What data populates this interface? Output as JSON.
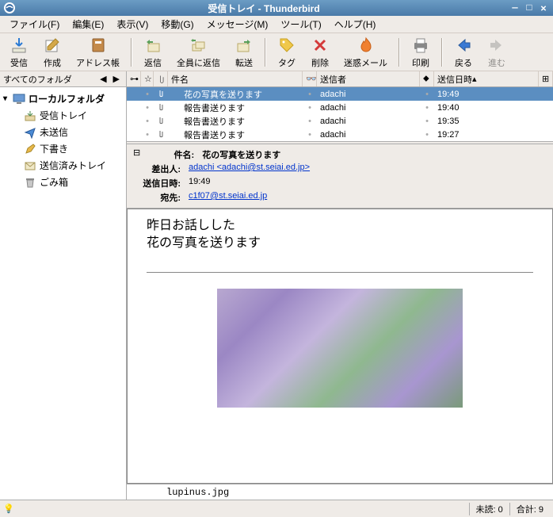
{
  "window": {
    "title": "受信トレイ  -  Thunderbird"
  },
  "menu": {
    "file": "ファイル(F)",
    "edit": "編集(E)",
    "view": "表示(V)",
    "go": "移動(G)",
    "message": "メッセージ(M)",
    "tools": "ツール(T)",
    "help": "ヘルプ(H)"
  },
  "toolbar": {
    "get": "受信",
    "write": "作成",
    "addressbook": "アドレス帳",
    "reply": "返信",
    "replyall": "全員に返信",
    "forward": "転送",
    "tag": "タグ",
    "delete": "削除",
    "junk": "迷惑メール",
    "print": "印刷",
    "back": "戻る",
    "forward_nav": "進む"
  },
  "sidebar": {
    "header": "すべてのフォルダ",
    "root": "ローカルフォルダ",
    "items": [
      {
        "label": "受信トレイ"
      },
      {
        "label": "未送信"
      },
      {
        "label": "下書き"
      },
      {
        "label": "送信済みトレイ"
      },
      {
        "label": "ごみ箱"
      }
    ]
  },
  "columns": {
    "subject": "件名",
    "sender": "送信者",
    "date": "送信日時"
  },
  "messages": [
    {
      "attach": true,
      "subject": "花の写真を送ります",
      "sender": "adachi",
      "date": "19:49",
      "selected": true
    },
    {
      "attach": true,
      "subject": "報告書送ります",
      "sender": "adachi",
      "date": "19:40",
      "selected": false
    },
    {
      "attach": true,
      "subject": "報告書送ります",
      "sender": "adachi",
      "date": "19:35",
      "selected": false
    },
    {
      "attach": true,
      "subject": "報告書送ります",
      "sender": "adachi",
      "date": "19:27",
      "selected": false
    }
  ],
  "detail": {
    "subject_k": "件名:",
    "subject_v": "花の写真を送ります",
    "from_k": "差出人:",
    "from_v": "adachi <adachi@st.seiai.ed.jp>",
    "date_k": "送信日時:",
    "date_v": "19:49",
    "to_k": "宛先:",
    "to_v": "c1f07@st.seiai.ed.jp",
    "body1": "昨日お話しした",
    "body2": "花の写真を送ります",
    "attachment": "lupinus.jpg"
  },
  "status": {
    "unread_k": "未読:",
    "unread_v": "0",
    "total_k": "合計:",
    "total_v": "9"
  }
}
